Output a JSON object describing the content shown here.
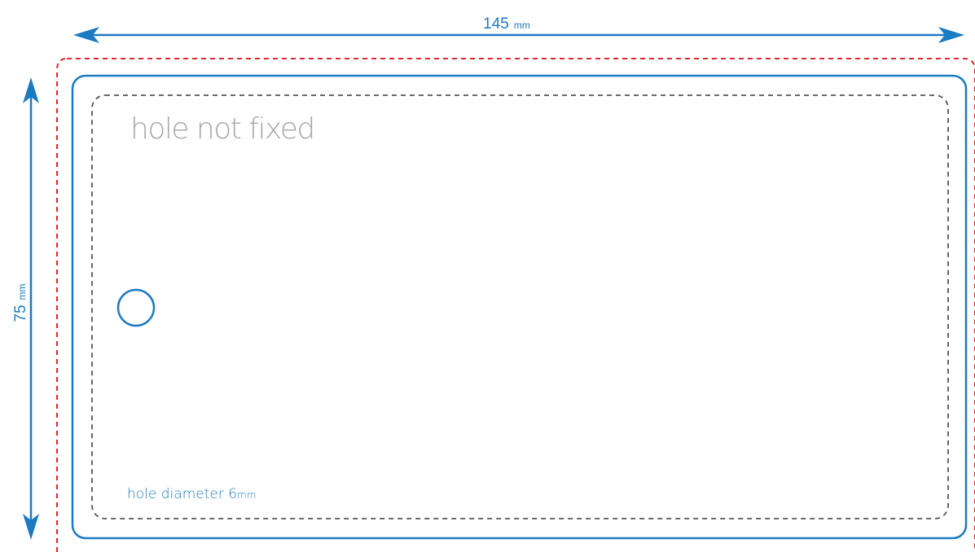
{
  "width_dimension": {
    "value": "145",
    "unit": "mm"
  },
  "height_dimension": {
    "value": "75",
    "unit": "mm"
  },
  "heading": "hole not fixed",
  "hole_note": {
    "text": "hole diameter 6",
    "unit": "mm"
  },
  "colors": {
    "dimension_blue": "#1b7bc2",
    "trim_outline": "#1b7bc2",
    "bleed_line": "#e3262f",
    "safe_area": "#555555",
    "heading_gray": "#a8a8a8"
  },
  "icons": {
    "hole": "circle-outline",
    "arrows": "double-headed-arrow"
  }
}
